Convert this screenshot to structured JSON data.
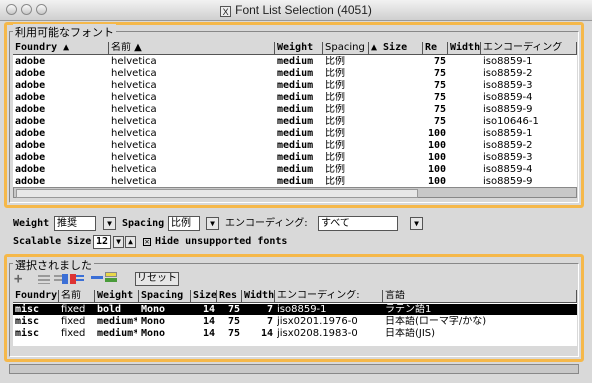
{
  "window": {
    "title": "Font List Selection (4051)",
    "title_icon": "X"
  },
  "available": {
    "label": "利用可能なフォント",
    "columns": [
      "Foundry ▲",
      "名前 ▲",
      "Weight",
      "Spacing",
      "▲ Size",
      "Re",
      "Width",
      "エンコーディング"
    ],
    "rows": [
      [
        "adobe",
        "helvetica",
        "medium",
        "比例",
        "",
        "75",
        "",
        "iso8859-1"
      ],
      [
        "adobe",
        "helvetica",
        "medium",
        "比例",
        "",
        "75",
        "",
        "iso8859-2"
      ],
      [
        "adobe",
        "helvetica",
        "medium",
        "比例",
        "",
        "75",
        "",
        "iso8859-3"
      ],
      [
        "adobe",
        "helvetica",
        "medium",
        "比例",
        "",
        "75",
        "",
        "iso8859-4"
      ],
      [
        "adobe",
        "helvetica",
        "medium",
        "比例",
        "",
        "75",
        "",
        "iso8859-9"
      ],
      [
        "adobe",
        "helvetica",
        "medium",
        "比例",
        "",
        "75",
        "",
        "iso10646-1"
      ],
      [
        "adobe",
        "helvetica",
        "medium",
        "比例",
        "",
        "100",
        "",
        "iso8859-1"
      ],
      [
        "adobe",
        "helvetica",
        "medium",
        "比例",
        "",
        "100",
        "",
        "iso8859-2"
      ],
      [
        "adobe",
        "helvetica",
        "medium",
        "比例",
        "",
        "100",
        "",
        "iso8859-3"
      ],
      [
        "adobe",
        "helvetica",
        "medium",
        "比例",
        "",
        "100",
        "",
        "iso8859-4"
      ],
      [
        "adobe",
        "helvetica",
        "medium",
        "比例",
        "",
        "100",
        "",
        "iso8859-9"
      ]
    ]
  },
  "filters": {
    "weight_label": "Weight",
    "weight_value": "推奨",
    "spacing_label": "Spacing",
    "spacing_value": "比例",
    "encoding_label": "エンコーディング:",
    "encoding_value": "すべて",
    "scalable_label": "Scalable Size",
    "scalable_value": "12",
    "hide_label": "Hide unsupported fonts",
    "hide_checked": true
  },
  "selected": {
    "label": "選択されました",
    "reset_label": "リセット",
    "columns": [
      "Foundry",
      "名前",
      "Weight",
      "Spacing",
      "Size",
      "Res",
      "Width",
      "エンコーディング:",
      "言語"
    ],
    "rows": [
      [
        "misc",
        "fixed",
        "bold",
        "Mono",
        "14",
        "75",
        "7",
        "iso8859-1",
        "ラテン語1"
      ],
      [
        "misc",
        "fixed",
        "medium*",
        "Mono",
        "14",
        "75",
        "7",
        "jisx0201.1976-0",
        "日本語(ローマ字/かな)"
      ],
      [
        "misc",
        "fixed",
        "medium*",
        "Mono",
        "14",
        "75",
        "14",
        "jisx0208.1983-0",
        "日本語(JIS)"
      ]
    ],
    "selected_row": 0
  },
  "colors": {
    "highlight_frame": "#f5b84a",
    "window_bg": "#d9d9d9",
    "selection_bg": "#000000"
  }
}
